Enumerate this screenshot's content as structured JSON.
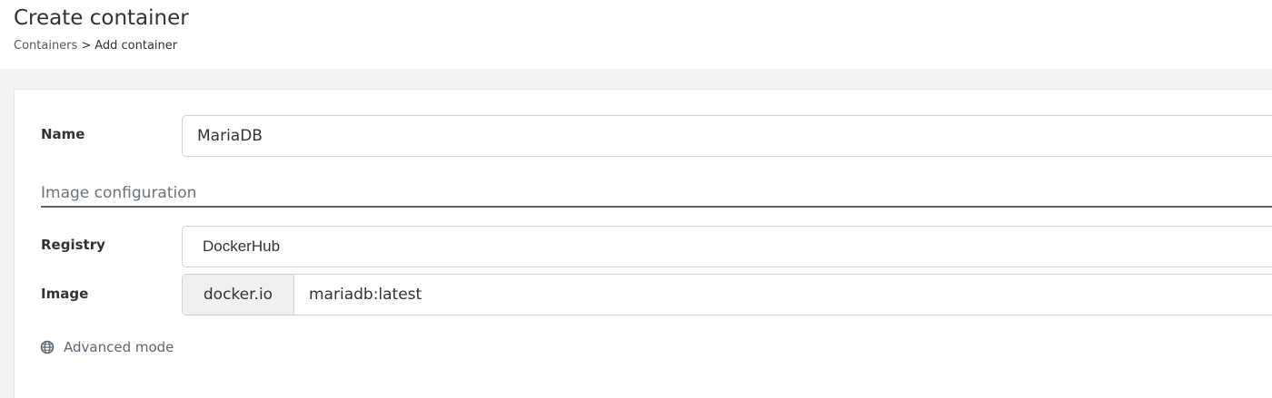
{
  "header": {
    "title": "Create container",
    "breadcrumb": {
      "parent": "Containers",
      "separator": ">",
      "current": "Add container"
    }
  },
  "form": {
    "name": {
      "label": "Name",
      "value": "MariaDB"
    },
    "image_section": {
      "title": "Image configuration"
    },
    "registry": {
      "label": "Registry",
      "value": "DockerHub"
    },
    "image": {
      "label": "Image",
      "prefix": "docker.io",
      "value": "mariadb:latest"
    },
    "advanced_mode": {
      "label": "Advanced mode",
      "icon": "globe-icon"
    }
  },
  "colors": {
    "page_background": "#f2f4f3",
    "panel_background": "#ffffff",
    "section_title": "#6b747c",
    "section_rule": "#5a6168",
    "input_border": "#cfd3d8",
    "addon_background": "#eef0f2",
    "link": "#5d6770"
  }
}
